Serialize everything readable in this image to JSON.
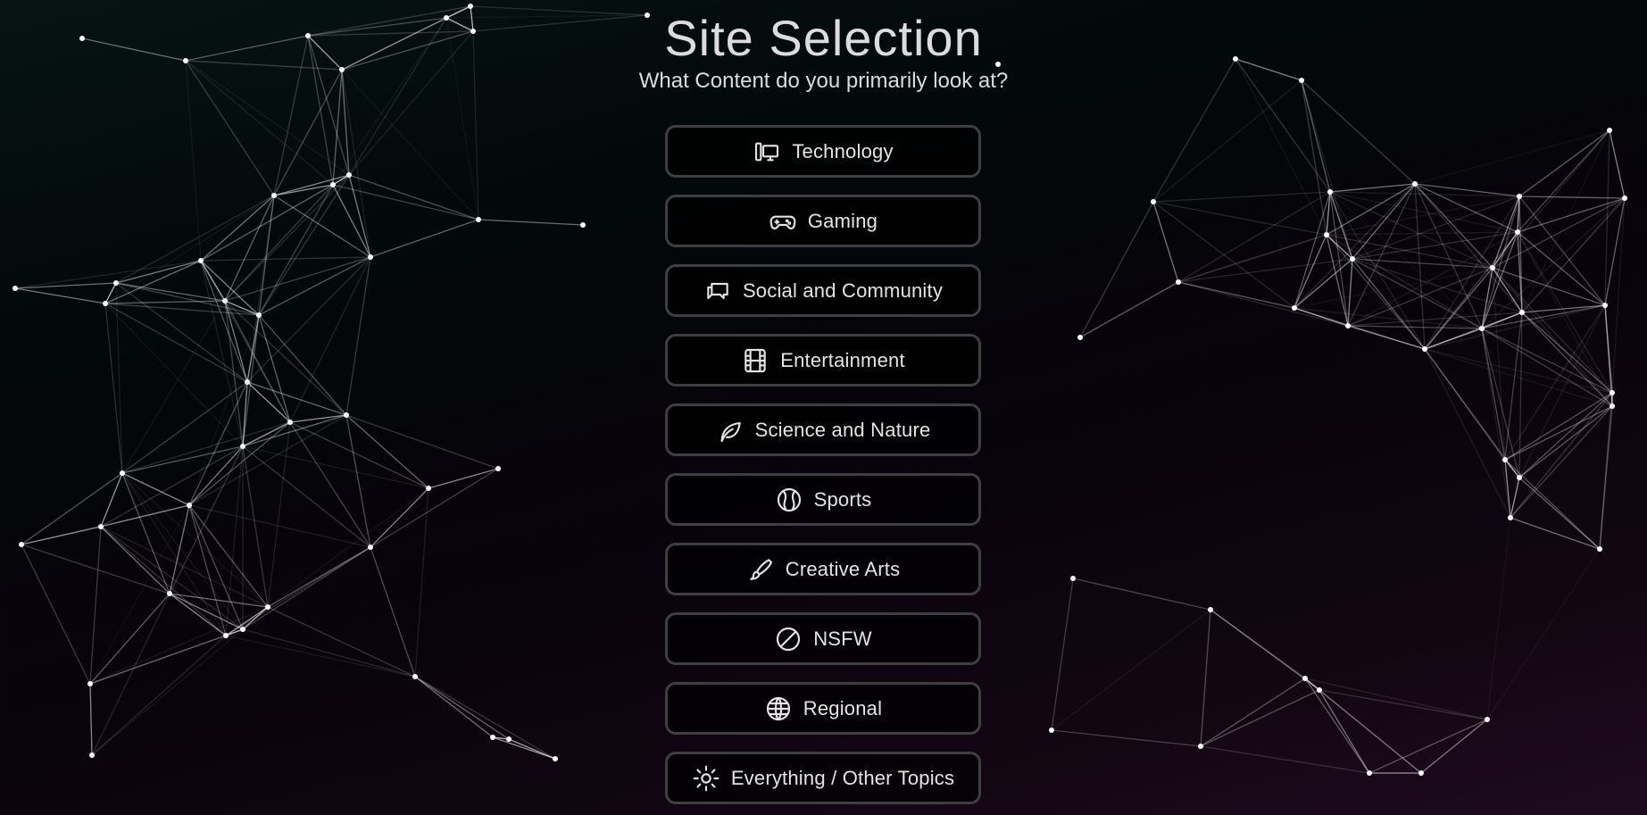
{
  "header": {
    "title": "Site Selection",
    "subtitle": "What Content do you primarily look at?"
  },
  "options": [
    {
      "label": "Technology",
      "icon": "devices-icon"
    },
    {
      "label": "Gaming",
      "icon": "gamepad-icon"
    },
    {
      "label": "Social and Community",
      "icon": "chat-bubbles-icon"
    },
    {
      "label": "Entertainment",
      "icon": "film-icon"
    },
    {
      "label": "Science and Nature",
      "icon": "leaf-icon"
    },
    {
      "label": "Sports",
      "icon": "baseball-icon"
    },
    {
      "label": "Creative Arts",
      "icon": "paintbrush-icon"
    },
    {
      "label": "NSFW",
      "icon": "prohibited-icon"
    },
    {
      "label": "Regional",
      "icon": "globe-icon"
    },
    {
      "label": "Everything / Other Topics",
      "icon": "sun-icon"
    }
  ],
  "colors": {
    "background_top": "#061413",
    "background_bottom": "#1e0a1f",
    "button_border": "#3f3f43",
    "text": "#e4e4e7",
    "network_lines": "#ffffff"
  }
}
